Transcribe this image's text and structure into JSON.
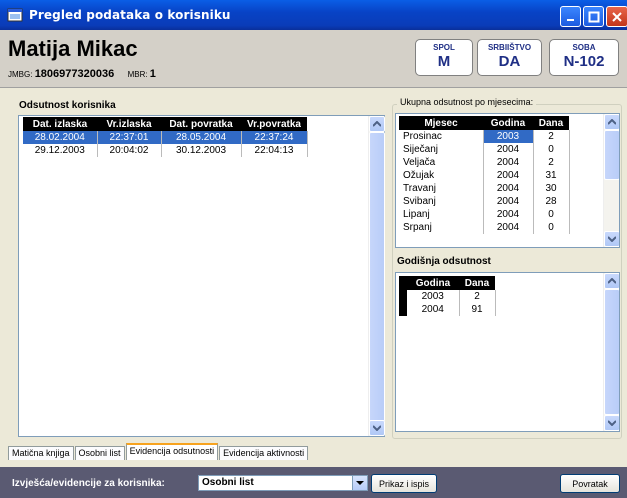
{
  "window": {
    "title": "Pregled podataka o korisniku"
  },
  "header": {
    "name": "Matija Mikac",
    "jmbg_label": "JMBG:",
    "jmbg": "1806977320036",
    "mbr_label": "MBR:",
    "mbr": "1",
    "badges": [
      {
        "label": "SPOL",
        "value": "M"
      },
      {
        "label": "SRBIIŠTVO",
        "value": "DA"
      },
      {
        "label": "SOBA",
        "value": "N-102"
      }
    ]
  },
  "absence": {
    "title": "Odsutnost korisnika",
    "columns": [
      "Dat. izlaska",
      "Vr.izlaska",
      "Dat. povratka",
      "Vr.povratka"
    ],
    "rows": [
      [
        "28.02.2004",
        "22:37:01",
        "28.05.2004",
        "22:37:24"
      ],
      [
        "29.12.2003",
        "20:04:02",
        "30.12.2003",
        "22:04:13"
      ]
    ]
  },
  "monthly": {
    "title": "Ukupna odsutnost po mjesecima:",
    "columns": [
      "Mjesec",
      "Godina",
      "Dana"
    ],
    "rows": [
      [
        "Prosinac",
        "2003",
        "2"
      ],
      [
        "Siječanj",
        "2004",
        "0"
      ],
      [
        "Veljača",
        "2004",
        "2"
      ],
      [
        "Ožujak",
        "2004",
        "31"
      ],
      [
        "Travanj",
        "2004",
        "30"
      ],
      [
        "Svibanj",
        "2004",
        "28"
      ],
      [
        "Lipanj",
        "2004",
        "0"
      ],
      [
        "Srpanj",
        "2004",
        "0"
      ]
    ]
  },
  "yearly": {
    "title": "Godišnja odsutnost",
    "columns": [
      "Godina",
      "Dana"
    ],
    "rows": [
      [
        "2003",
        "2"
      ],
      [
        "2004",
        "91"
      ]
    ]
  },
  "tabs": [
    "Matična knjiga",
    "Osobni list",
    "Evidencija odsutnosti",
    "Evidencija aktivnosti"
  ],
  "bottom": {
    "label": "Izvješća/evidencije za korisnika:",
    "selected": "Osobni list",
    "print_button": "Prikaz i ispis",
    "back_button": "Povratak"
  },
  "colors": {
    "title_bar": "#0a4ed0",
    "selection": "#316ac5",
    "badge_text": "#1f2f85",
    "bottom_bar": "#5a5a72"
  }
}
